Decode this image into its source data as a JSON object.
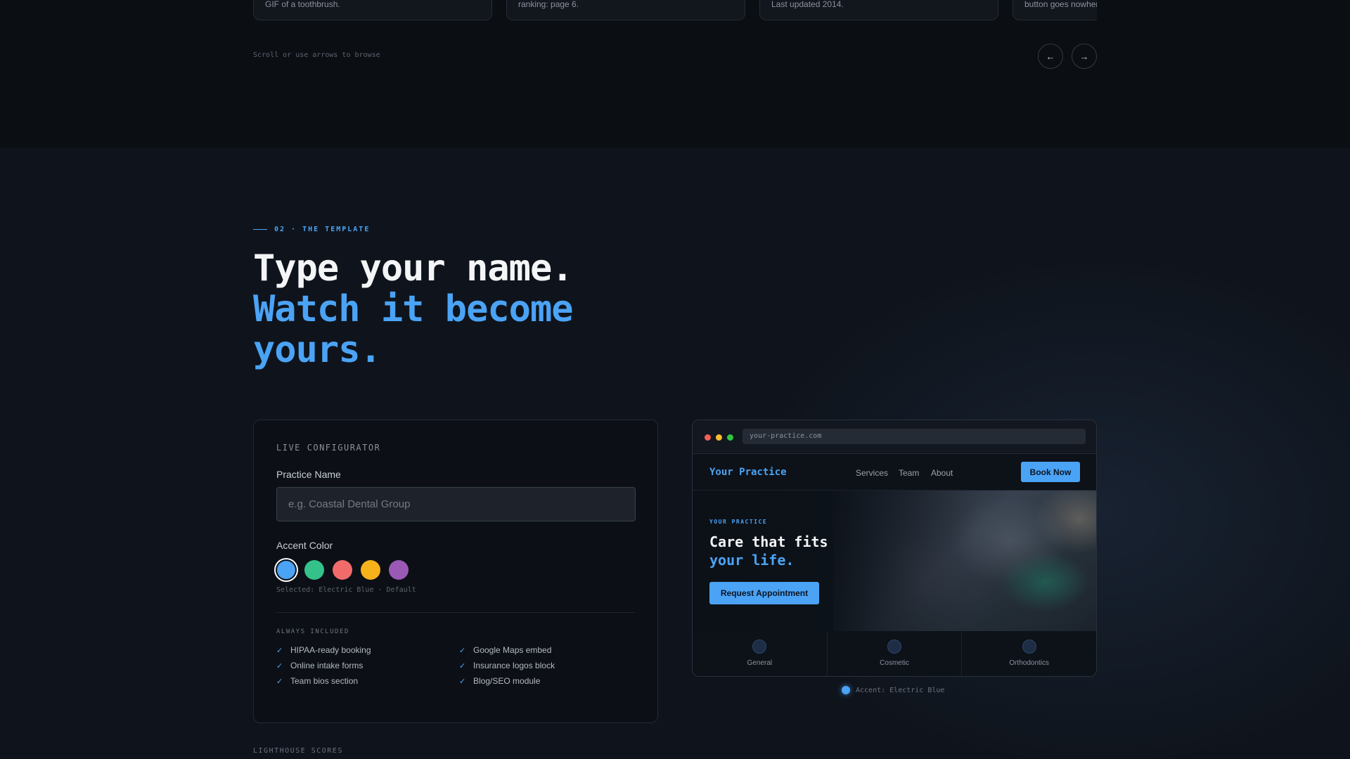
{
  "carousel": {
    "cards": [
      {
        "text": "GIF of a toothbrush."
      },
      {
        "text": "ranking: page 6."
      },
      {
        "text": "Last updated 2014."
      },
      {
        "text": "button goes nowhere."
      }
    ],
    "hint": "Scroll or use arrows to browse",
    "prev_icon": "←",
    "next_icon": "→"
  },
  "section": {
    "eyebrow": "02 · THE TEMPLATE",
    "headline_line1": "Type your name.",
    "headline_line2": "Watch it become yours."
  },
  "configurator": {
    "title": "LIVE CONFIGURATOR",
    "practice_label": "Practice Name",
    "practice_value": "",
    "practice_placeholder": "e.g. Coastal Dental Group",
    "accent_label": "Accent Color",
    "swatches": [
      {
        "name": "Electric Blue",
        "color": "#4ba3f5",
        "selected": true
      },
      {
        "name": "green",
        "color": "#34c28a",
        "selected": false
      },
      {
        "name": "coral",
        "color": "#f26b6b",
        "selected": false
      },
      {
        "name": "amber",
        "color": "#f6b21b",
        "selected": false
      },
      {
        "name": "purple",
        "color": "#9b59b6",
        "selected": false
      }
    ],
    "selected_note": "Selected: Electric Blue · Default",
    "included_title": "ALWAYS INCLUDED",
    "features": [
      "HIPAA-ready booking",
      "Google Maps embed",
      "Online intake forms",
      "Insurance logos block",
      "Team bios section",
      "Blog/SEO module"
    ]
  },
  "preview": {
    "url": "your-practice.com",
    "brand": "Your Practice",
    "nav_links": [
      "Services",
      "Team",
      "About"
    ],
    "book_label": "Book Now",
    "hero_eyebrow": "YOUR PRACTICE",
    "hero_line1": "Care that fits",
    "hero_line2": "your life.",
    "cta_label": "Request Appointment",
    "services": [
      "General",
      "Cosmetic",
      "Orthodontics"
    ],
    "accent_color": "#4ba3f5"
  },
  "accent_readout": "Accent: Electric Blue",
  "lighthouse_label": "LIGHTHOUSE SCORES"
}
